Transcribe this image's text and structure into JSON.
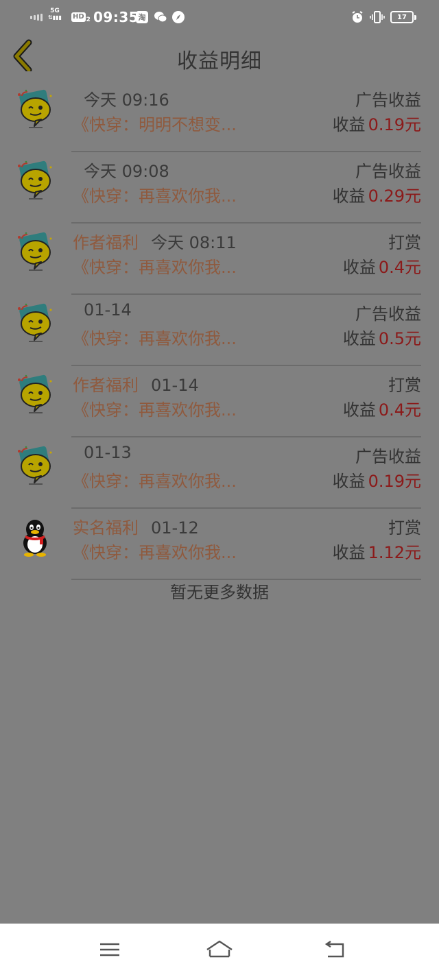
{
  "status_bar": {
    "network": "5G",
    "hd": "HD",
    "hd_sub": "2",
    "time": "09:35",
    "app_icon_1": "淘",
    "battery": "17"
  },
  "header": {
    "title": "收益明细",
    "back_icon": "chevron-left-icon"
  },
  "colors": {
    "background": "#808080",
    "tag_color": "#8f5a3e",
    "amount_color": "#8b1a1a",
    "back_chevron": "#8a7a00"
  },
  "records": [
    {
      "avatar": "chat-bubble-emoji-icon",
      "tag": "",
      "time": "今天 09:16",
      "kind": "广告收益",
      "book": "《快穿：明明不想变...",
      "earning_label": "收益",
      "amount": "0.19元"
    },
    {
      "avatar": "chat-bubble-emoji-icon",
      "tag": "",
      "time": "今天 09:08",
      "kind": "广告收益",
      "book": "《快穿：再喜欢你我...",
      "earning_label": "收益",
      "amount": "0.29元"
    },
    {
      "avatar": "chat-bubble-emoji-icon",
      "tag": "作者福利",
      "time": "今天 08:11",
      "kind": "打赏",
      "book": "《快穿：再喜欢你我...",
      "earning_label": "收益",
      "amount": "0.4元"
    },
    {
      "avatar": "chat-bubble-emoji-icon",
      "tag": "",
      "time": "01-14",
      "kind": "广告收益",
      "book": "《快穿：再喜欢你我...",
      "earning_label": "收益",
      "amount": "0.5元"
    },
    {
      "avatar": "chat-bubble-emoji-icon",
      "tag": "作者福利",
      "time": "01-14",
      "kind": "打赏",
      "book": "《快穿：再喜欢你我...",
      "earning_label": "收益",
      "amount": "0.4元"
    },
    {
      "avatar": "chat-bubble-emoji-icon",
      "tag": "",
      "time": "01-13",
      "kind": "广告收益",
      "book": "《快穿：再喜欢你我...",
      "earning_label": "收益",
      "amount": "0.19元"
    },
    {
      "avatar": "penguin-icon",
      "tag": "实名福利",
      "time": "01-12",
      "kind": "打赏",
      "book": "《快穿：再喜欢你我...",
      "earning_label": "收益",
      "amount": "1.12元"
    }
  ],
  "footer_text": "暂无更多数据",
  "nav_bar": {
    "menu_icon": "menu-icon",
    "home_icon": "home-icon",
    "back_icon": "back-icon"
  }
}
